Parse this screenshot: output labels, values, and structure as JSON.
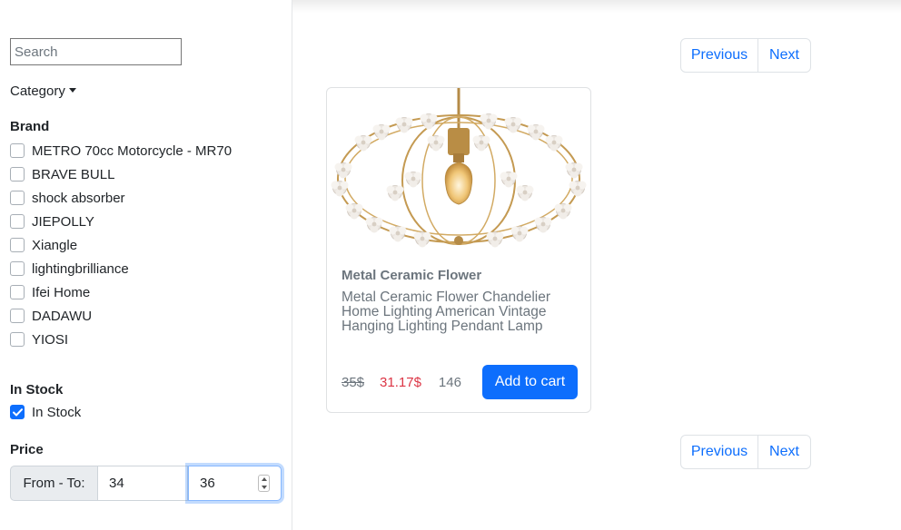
{
  "sidebar": {
    "search": {
      "placeholder": "Search",
      "value": ""
    },
    "category_label": "Category",
    "brand_title": "Brand",
    "brands": [
      {
        "label": "METRO 70cc Motorcycle - MR70",
        "checked": false
      },
      {
        "label": "BRAVE BULL",
        "checked": false
      },
      {
        "label": "shock absorber",
        "checked": false
      },
      {
        "label": "JIEPOLLY",
        "checked": false
      },
      {
        "label": "Xiangle",
        "checked": false
      },
      {
        "label": "lightingbrilliance",
        "checked": false
      },
      {
        "label": "Ifei Home",
        "checked": false
      },
      {
        "label": "DADAWU",
        "checked": false
      },
      {
        "label": "YIOSI",
        "checked": false
      }
    ],
    "instock_title": "In Stock",
    "instock": {
      "label": "In Stock",
      "checked": true
    },
    "price_title": "Price",
    "price": {
      "prefix": "From - To:",
      "from": "34",
      "to": "36"
    }
  },
  "pagination": {
    "previous": "Previous",
    "next": "Next"
  },
  "product": {
    "title": "Metal Ceramic Flower",
    "description": "Metal Ceramic Flower Chandelier Home Lighting American Vintage Hanging Lighting Pendant Lamp",
    "old_price": "35$",
    "new_price": "31.17$",
    "stock": "146",
    "cart_label": "Add to cart",
    "image_icon": "chandelier-image"
  },
  "colors": {
    "accent": "#0d6efd",
    "sale": "#dc3545",
    "muted": "#6c757d"
  }
}
